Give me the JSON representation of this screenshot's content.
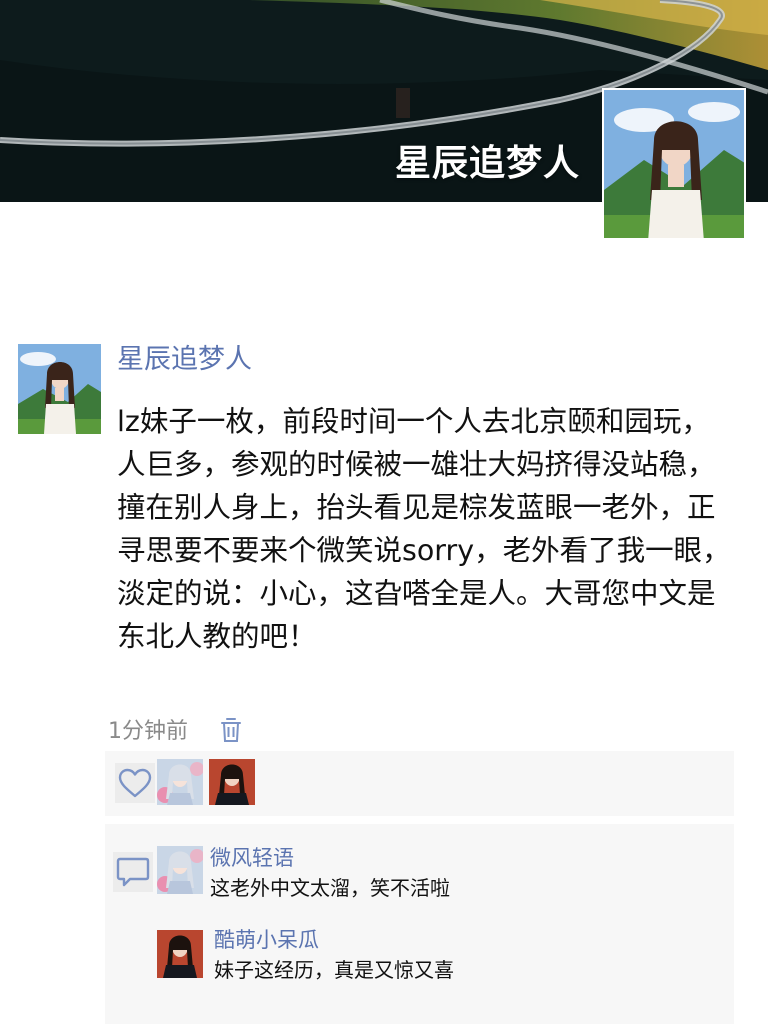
{
  "profile": {
    "cover_name": "星辰追梦人"
  },
  "post": {
    "author": "星辰追梦人",
    "text": "lz妹子一枚，前段时间一个人去北京颐和园玩，人巨多，参观的时候被一雄壮大妈挤得没站稳，撞在别人身上，抬头看见是棕发蓝眼一老外，正寻思要不要来个微笑说sorry，老外看了我一眼，淡定的说：小心，这旮嗒全是人。大哥您中文是东北人教的吧！",
    "time": "1分钟前"
  },
  "likes": {
    "icon": "heart-icon",
    "avatars": [
      "liker-avatar-1",
      "liker-avatar-2"
    ]
  },
  "comments": [
    {
      "author": "微风轻语",
      "text": "这老外中文太溜，笑不活啦"
    },
    {
      "author": "酷萌小呆瓜",
      "text": "妹子这经历，真是又惊又喜"
    }
  ],
  "colors": {
    "link": "#5b74b0",
    "panel": "#f7f7f7",
    "icon": "#7b93c6"
  }
}
